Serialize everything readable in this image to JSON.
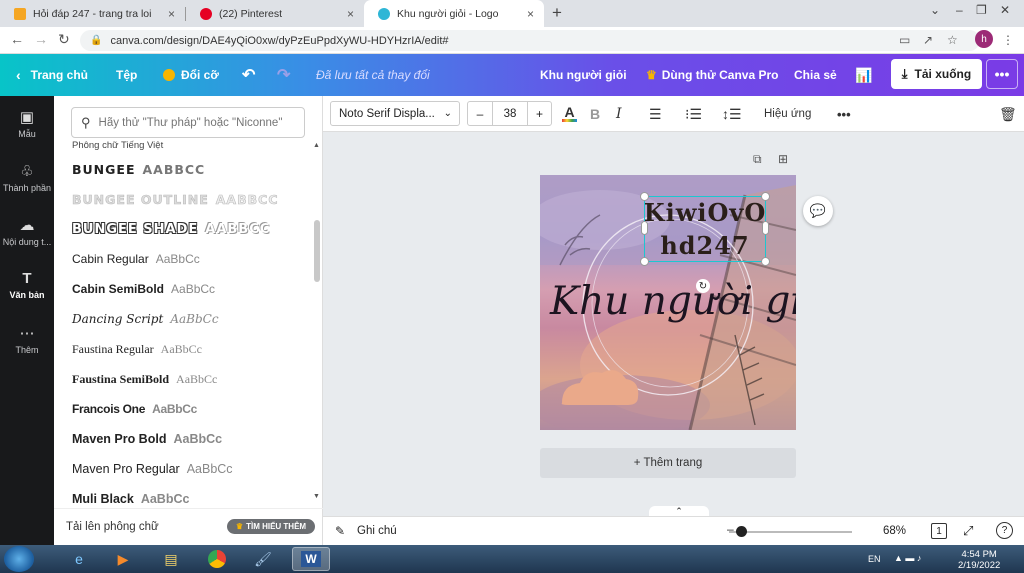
{
  "browser": {
    "tabs": [
      {
        "title": "Hỏi đáp 247 - trang tra loi",
        "close": "×"
      },
      {
        "title": "(22) Pinterest",
        "close": "×"
      },
      {
        "title": "Khu người giỏi - Logo",
        "close": "×"
      }
    ],
    "new_tab": "+",
    "url": "canva.com/design/DAE4yQiO0xw/dyPzEuPpdXyWU-HDYHzrIA/edit#",
    "profile_initial": "h",
    "window_controls": {
      "chevron": "⌄",
      "minimize": "–",
      "restore": "❐",
      "close": "✕"
    }
  },
  "header": {
    "home": "Trang chủ",
    "file": "Tệp",
    "resize": "Đổi cỡ",
    "saved_status": "Đã lưu tất cả thay đổi",
    "design_title": "Khu người giỏi",
    "try_pro": "Dùng thử Canva Pro",
    "share": "Chia sẻ",
    "download": "Tải xuống",
    "more": "•••"
  },
  "rail": {
    "items": [
      {
        "label": "Mẫu",
        "icon": "template-icon"
      },
      {
        "label": "Thành phần",
        "icon": "elements-icon"
      },
      {
        "label": "Nội dung t...",
        "icon": "upload-icon"
      },
      {
        "label": "Văn bản",
        "icon": "text-icon"
      },
      {
        "label": "Thêm",
        "icon": "more-icon"
      }
    ]
  },
  "font_panel": {
    "search_placeholder": "Hãy thử \"Thư pháp\" hoặc \"Niconne\"",
    "section_label": "Phông chữ Tiếng Việt",
    "fonts": [
      {
        "name": "BUNGEE",
        "sample": "AABBCC"
      },
      {
        "name": "BUNGEE OUTLINE",
        "sample": "AABBCC"
      },
      {
        "name": "BUNGEE SHADE",
        "sample": "AABBCC"
      },
      {
        "name": "Cabin Regular",
        "sample": "AaBbCc"
      },
      {
        "name": "Cabin SemiBold",
        "sample": "AaBbCc"
      },
      {
        "name": "Dancing Script",
        "sample": "AaBbCc"
      },
      {
        "name": "Faustina Regular",
        "sample": "AaBbCc"
      },
      {
        "name": "Faustina SemiBold",
        "sample": "AaBbCc"
      },
      {
        "name": "Francois One",
        "sample": "AaBbCc"
      },
      {
        "name": "Maven Pro Bold",
        "sample": "AaBbCc"
      },
      {
        "name": "Maven Pro Regular",
        "sample": "AaBbCc"
      },
      {
        "name": "Muli Black",
        "sample": "AaBbCc"
      }
    ],
    "upload_label": "Tải lên phông chữ",
    "learn_more": "TÌM HIỂU THÊM"
  },
  "toolbar": {
    "font_name": "Noto Serif Displa...",
    "font_size": "38",
    "minus": "–",
    "plus": "+",
    "bold": "B",
    "italic": "I",
    "effects": "Hiệu ứng",
    "more": "•••"
  },
  "canvas": {
    "text_kiwi_line1": "KiwiOvO",
    "text_kiwi_line2": "hd247",
    "text_script": "Khu người giỏi",
    "add_page": "+ Thêm trang"
  },
  "bottom": {
    "notes": "Ghi chú",
    "zoom": "68%",
    "page_count": "1",
    "help": "?"
  },
  "taskbar": {
    "lang": "EN",
    "time": "4:54 PM",
    "date": "2/19/2022"
  },
  "colors": {
    "selection": "#1cc7d0",
    "header_start": "#08c4c8",
    "header_end": "#7a3be6",
    "rail_bg": "#18191b"
  }
}
